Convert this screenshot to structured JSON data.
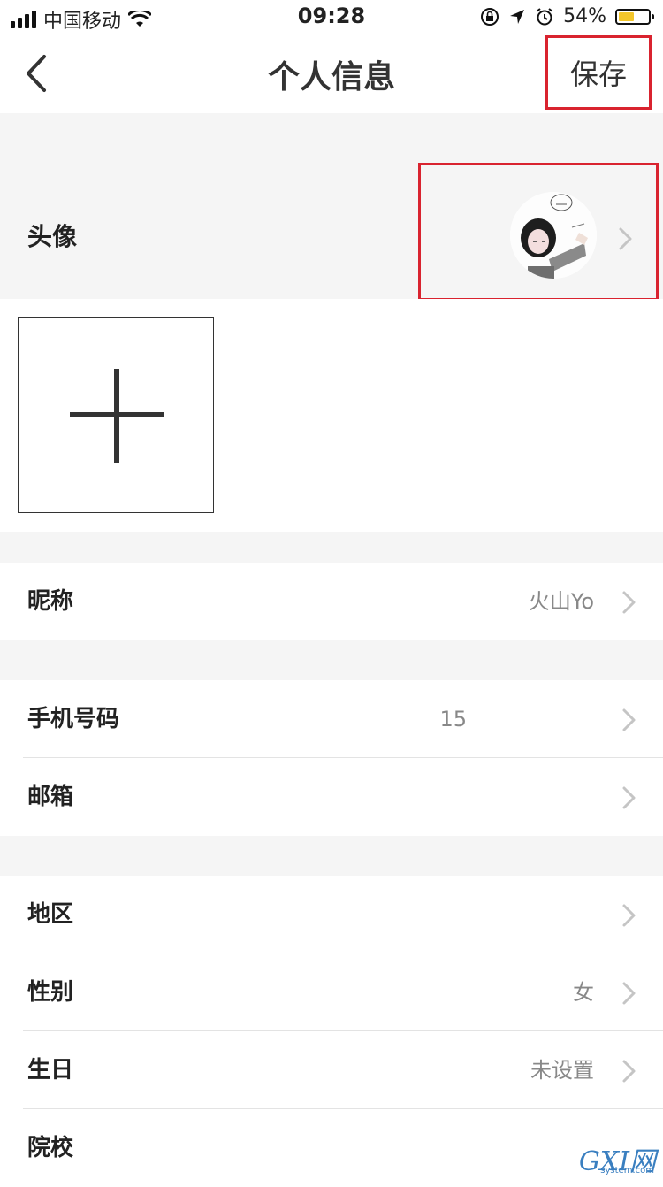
{
  "status_bar": {
    "carrier": "中国移动",
    "time": "09:28",
    "battery_percent": "54%",
    "battery_level": 0.54
  },
  "nav": {
    "title": "个人信息",
    "save_label": "保存"
  },
  "avatar_row": {
    "label": "头像"
  },
  "rows": {
    "nickname": {
      "label": "昵称",
      "value": "火山Yo"
    },
    "phone": {
      "label": "手机号码",
      "value": "15"
    },
    "email": {
      "label": "邮箱",
      "value": ""
    },
    "region": {
      "label": "地区",
      "value": ""
    },
    "gender": {
      "label": "性别",
      "value": "女"
    },
    "birthday": {
      "label": "生日",
      "value": "未设置"
    },
    "school": {
      "label": "院校",
      "value": ""
    }
  },
  "watermark": {
    "main": "GXI网",
    "sub": "system.com"
  },
  "colors": {
    "highlight_border": "#d9232f",
    "battery_fill": "#f3c62b",
    "separator": "#f5f5f5"
  }
}
